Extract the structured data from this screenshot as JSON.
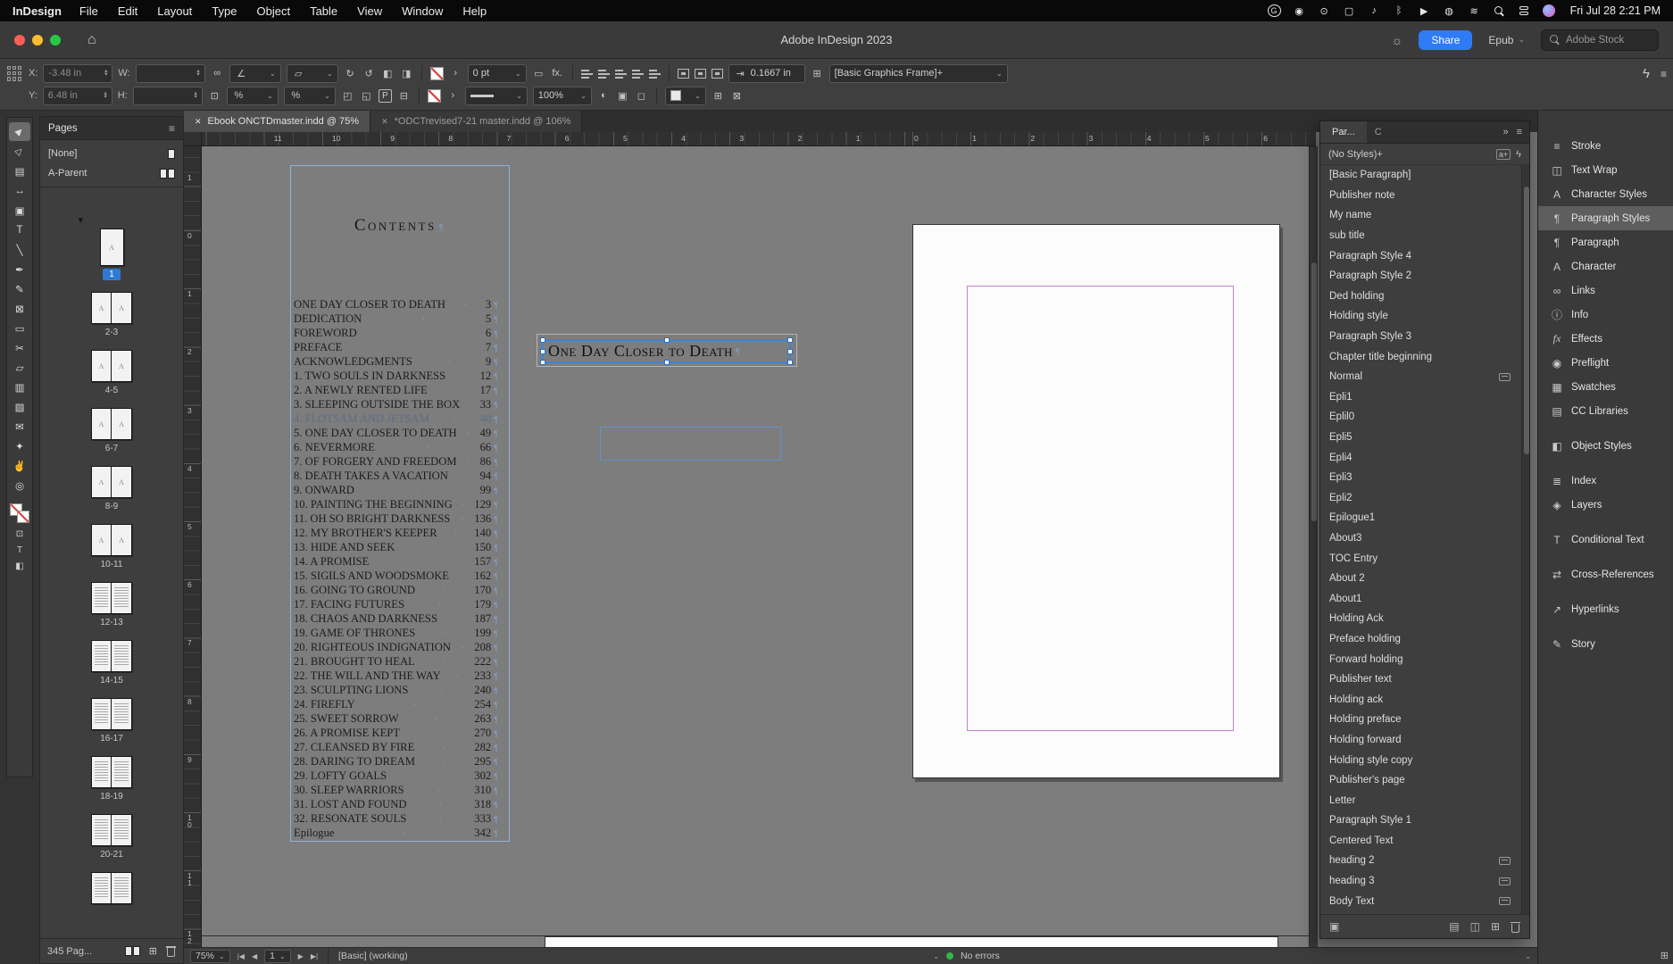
{
  "menubar": {
    "app": "InDesign",
    "menus": [
      "File",
      "Edit",
      "Layout",
      "Type",
      "Object",
      "Table",
      "View",
      "Window",
      "Help"
    ],
    "clock": "Fri Jul 28 2:21 PM",
    "status_icons": [
      {
        "name": "grammarly-icon",
        "glyph": "G"
      },
      {
        "name": "camera-icon",
        "glyph": "◉"
      },
      {
        "name": "record-icon",
        "glyph": "⊙"
      },
      {
        "name": "display-icon",
        "glyph": "▢"
      },
      {
        "name": "volume-icon",
        "glyph": "♪"
      },
      {
        "name": "bluetooth-icon",
        "glyph": "ᛒ"
      },
      {
        "name": "play-icon",
        "glyph": "▶"
      },
      {
        "name": "globe-icon",
        "glyph": "◍"
      },
      {
        "name": "wifi-icon",
        "glyph": "≋"
      },
      {
        "name": "spotlight-search-icon",
        "glyph": "mag"
      },
      {
        "name": "control-center-icon",
        "glyph": "cc"
      },
      {
        "name": "siri-icon",
        "glyph": "siri"
      }
    ]
  },
  "titlebar": {
    "title": "Adobe InDesign 2023",
    "share_label": "Share",
    "workspace": "Epub",
    "stock_placeholder": "Adobe Stock"
  },
  "control_panel": {
    "x_label": "X:",
    "x_value": "-3.48 in",
    "y_label": "Y:",
    "y_value": "6.48 in",
    "w_label": "W:",
    "h_label": "H:",
    "stroke_weight": "0 pt",
    "stroke_scale": "100%",
    "offset_value": "0.1667 in",
    "object_style": "[Basic Graphics Frame]+"
  },
  "tabs": [
    {
      "label": "Ebook ONCTDmaster.indd @ 75%",
      "active": true
    },
    {
      "label": "*ODCTrevised7-21 master.indd @ 106%",
      "active": false
    }
  ],
  "tools": [
    {
      "name": "selection-tool",
      "glyph": "▶",
      "selected": true
    },
    {
      "name": "direct-selection-tool",
      "glyph": "▷"
    },
    {
      "name": "page-tool",
      "glyph": "▤"
    },
    {
      "name": "gap-tool",
      "glyph": "↔"
    },
    {
      "name": "content-collector-tool",
      "glyph": "▣"
    },
    {
      "name": "type-tool",
      "glyph": "T"
    },
    {
      "name": "line-tool",
      "glyph": "╲"
    },
    {
      "name": "pen-tool",
      "glyph": "✒"
    },
    {
      "name": "pencil-tool",
      "glyph": "✎"
    },
    {
      "name": "rectangle-frame-tool",
      "glyph": "⊠"
    },
    {
      "name": "rectangle-tool",
      "glyph": "▭"
    },
    {
      "name": "scissors-tool",
      "glyph": "✂"
    },
    {
      "name": "free-transform-tool",
      "glyph": "▱"
    },
    {
      "name": "gradient-swatch-tool",
      "glyph": "▥"
    },
    {
      "name": "gradient-feather-tool",
      "glyph": "▨"
    },
    {
      "name": "note-tool",
      "glyph": "✉"
    },
    {
      "name": "color-theme-tool",
      "glyph": "✦"
    },
    {
      "name": "hand-tool",
      "glyph": "✌"
    },
    {
      "name": "zoom-tool",
      "glyph": "◎"
    }
  ],
  "rulers": {
    "horizontal": [
      "11",
      "10",
      "9",
      "8",
      "7",
      "6",
      "5",
      "4",
      "3",
      "2",
      "1",
      "0",
      "1",
      "2",
      "3",
      "4",
      "5",
      "6"
    ],
    "vertical": [
      "1",
      "0",
      "1",
      "2",
      "3",
      "4",
      "5",
      "6",
      "7",
      "8",
      "9",
      "10",
      "11",
      "12"
    ]
  },
  "pages_panel": {
    "title": "Pages",
    "masters": [
      "[None]",
      "A-Parent"
    ],
    "pages": [
      {
        "type": "single",
        "label": "1",
        "master": "A",
        "selected": true
      },
      {
        "type": "spread",
        "label": "2-3",
        "master": "A"
      },
      {
        "type": "spread",
        "label": "4-5",
        "master": "A"
      },
      {
        "type": "spread",
        "label": "6-7",
        "master": "A"
      },
      {
        "type": "spread",
        "label": "8-9",
        "master": "A"
      },
      {
        "type": "spread",
        "label": "10-11",
        "master": "A"
      },
      {
        "type": "spread",
        "label": "12-13",
        "lines": true
      },
      {
        "type": "spread",
        "label": "14-15",
        "lines": true
      },
      {
        "type": "spread",
        "label": "16-17",
        "lines": true
      },
      {
        "type": "spread",
        "label": "18-19",
        "lines": true
      },
      {
        "type": "spread",
        "label": "20-21",
        "lines": true
      },
      {
        "type": "spread",
        "label": "",
        "lines": true
      }
    ],
    "footer": "345 Pag..."
  },
  "document": {
    "toc_title": "Contents",
    "heading": "One Day Closer to Death",
    "toc_entries": [
      {
        "t": "ONE DAY CLOSER TO DEATH",
        "p": "3"
      },
      {
        "t": "DEDICATION",
        "p": "5"
      },
      {
        "t": "FOREWORD",
        "p": "6"
      },
      {
        "t": "PREFACE",
        "p": "7"
      },
      {
        "t": "ACKNOWLEDGMENTS",
        "p": "9"
      },
      {
        "t": "1. TWO SOULS IN DARKNESS",
        "p": "12"
      },
      {
        "t": "2. A NEWLY RENTED LIFE",
        "p": "17"
      },
      {
        "t": "3. SLEEPING OUTSIDE THE BOX",
        "p": "33"
      },
      {
        "t": "4. FLOTSAM AND JETSAM",
        "p": "40",
        "muted": true
      },
      {
        "t": "5. ONE DAY CLOSER TO DEATH",
        "p": "49"
      },
      {
        "t": "6. NEVERMORE",
        "p": "66"
      },
      {
        "t": "7. OF FORGERY AND FREEDOM",
        "p": "86"
      },
      {
        "t": "8. DEATH TAKES A VACATION",
        "p": "94"
      },
      {
        "t": "9. ONWARD",
        "p": "99"
      },
      {
        "t": "10. PAINTING THE BEGINNING",
        "p": "129"
      },
      {
        "t": "11. OH SO BRIGHT DARKNESS",
        "p": "136"
      },
      {
        "t": "12. MY BROTHER'S KEEPER",
        "p": "140"
      },
      {
        "t": "13. HIDE AND SEEK",
        "p": "150"
      },
      {
        "t": "14. A PROMISE",
        "p": "157"
      },
      {
        "t": "15. SIGILS AND WOODSMOKE",
        "p": "162"
      },
      {
        "t": "16. GOING TO GROUND",
        "p": "170"
      },
      {
        "t": "17. FACING FUTURES",
        "p": "179"
      },
      {
        "t": "18. CHAOS AND DARKNESS",
        "p": "187"
      },
      {
        "t": "19. GAME OF THRONES",
        "p": "199"
      },
      {
        "t": "20. RIGHTEOUS INDIGNATION",
        "p": "208"
      },
      {
        "t": "21. BROUGHT TO HEAL",
        "p": "222"
      },
      {
        "t": "22. THE WILL AND THE WAY",
        "p": "233"
      },
      {
        "t": "23. SCULPTING LIONS",
        "p": "240"
      },
      {
        "t": "24. FIREFLY",
        "p": "254"
      },
      {
        "t": "25. SWEET SORROW",
        "p": "263"
      },
      {
        "t": "26. A PROMISE KEPT",
        "p": "270"
      },
      {
        "t": "27. CLEANSED BY FIRE",
        "p": "282"
      },
      {
        "t": "28. DARING TO DREAM",
        "p": "295"
      },
      {
        "t": "29. LOFTY GOALS",
        "p": "302"
      },
      {
        "t": "30. SLEEP WARRIORS",
        "p": "310"
      },
      {
        "t": "31. LOST AND FOUND",
        "p": "318"
      },
      {
        "t": "32. RESONATE SOULS",
        "p": "333"
      },
      {
        "t": "Epilogue",
        "p": "342"
      }
    ]
  },
  "styles_panel": {
    "tab_label": "Par...",
    "tab2_label": "C",
    "no_styles": "(No Styles)+",
    "items": [
      {
        "label": "[Basic Paragraph]"
      },
      {
        "label": "Publisher note"
      },
      {
        "label": "My name"
      },
      {
        "label": "sub title"
      },
      {
        "label": "Paragraph Style 4"
      },
      {
        "label": "Paragraph Style 2"
      },
      {
        "label": "Ded holding"
      },
      {
        "label": "Holding style"
      },
      {
        "label": "Paragraph Style 3"
      },
      {
        "label": "Chapter title beginning"
      },
      {
        "label": "Normal",
        "shortcut": true
      },
      {
        "label": "Epli1"
      },
      {
        "label": "Eplil0"
      },
      {
        "label": "Epli5"
      },
      {
        "label": "Epli4"
      },
      {
        "label": "Epli3"
      },
      {
        "label": "Epli2"
      },
      {
        "label": "Epilogue1"
      },
      {
        "label": "About3"
      },
      {
        "label": "TOC Entry"
      },
      {
        "label": "About 2"
      },
      {
        "label": "About1"
      },
      {
        "label": "Holding Ack"
      },
      {
        "label": "Preface holding"
      },
      {
        "label": "Forward holding"
      },
      {
        "label": "Publisher text"
      },
      {
        "label": "Holding ack"
      },
      {
        "label": "Holding preface"
      },
      {
        "label": "Holding forward"
      },
      {
        "label": "Holding style copy"
      },
      {
        "label": "Publisher's page"
      },
      {
        "label": "Letter"
      },
      {
        "label": "Paragraph Style 1"
      },
      {
        "label": "Centered Text"
      },
      {
        "label": "heading 2",
        "shortcut": true
      },
      {
        "label": "heading 3",
        "shortcut": true
      },
      {
        "label": "Body Text",
        "shortcut": true
      }
    ]
  },
  "dock": [
    {
      "label": "Stroke",
      "glyph": "≡"
    },
    {
      "label": "Text Wrap",
      "glyph": "◫"
    },
    {
      "label": "Character Styles",
      "glyph": "A"
    },
    {
      "label": "Paragraph Styles",
      "glyph": "¶",
      "active": true
    },
    {
      "label": "Paragraph",
      "glyph": "¶"
    },
    {
      "label": "Character",
      "glyph": "A"
    },
    {
      "label": "Links",
      "glyph": "∞"
    },
    {
      "label": "Info",
      "glyph": "ⓘ"
    },
    {
      "label": "Effects",
      "glyph": "fx"
    },
    {
      "label": "Preflight",
      "glyph": "◉"
    },
    {
      "label": "Swatches",
      "glyph": "▦"
    },
    {
      "label": "CC Libraries",
      "glyph": "▤"
    },
    {
      "label": "Object Styles",
      "glyph": "◧",
      "gap": true
    },
    {
      "label": "Index",
      "glyph": "≣",
      "gap": true
    },
    {
      "label": "Layers",
      "glyph": "◈"
    },
    {
      "label": "Conditional Text",
      "glyph": "T",
      "gap": true
    },
    {
      "label": "Cross-References",
      "glyph": "⇄",
      "gap": true
    },
    {
      "label": "Hyperlinks",
      "glyph": "↗",
      "gap": true
    },
    {
      "label": "Story",
      "glyph": "✎",
      "gap": true
    }
  ],
  "statusbar": {
    "zoom": "75%",
    "page": "1",
    "preflight": "[Basic] (working)",
    "errors": "No errors"
  }
}
